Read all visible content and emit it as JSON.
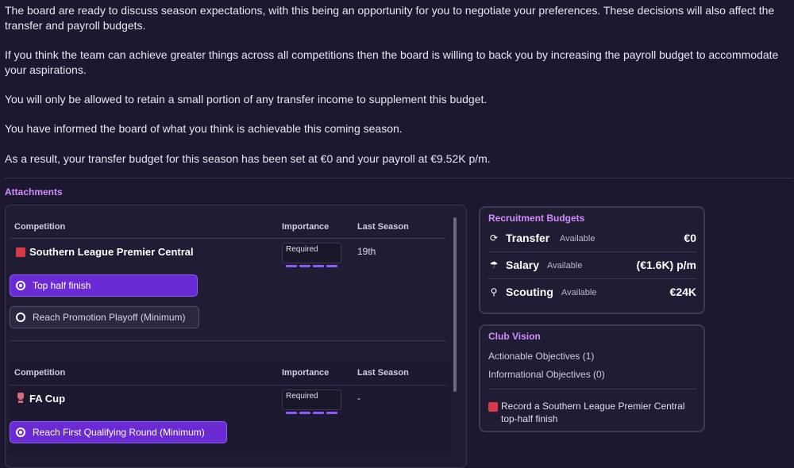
{
  "intro": {
    "p1": "The board are ready to discuss season expectations, with this being an opportunity for you to negotiate your preferences. These decisions will also affect the transfer and payroll budgets.",
    "p2": "If you think the team can achieve greater things across all competitions then the board is willing to back you by increasing the payroll budget to accommodate your aspirations.",
    "p3": "You will only be allowed to retain a small portion of any transfer income to supplement this budget.",
    "p4": "You have informed the board of what you think is achievable this coming season.",
    "p5": "As a result, your transfer budget for this season has been set at €0 and your payroll at €9.52K p/m."
  },
  "attachments": {
    "title": "Attachments",
    "columns": {
      "competition": "Competition",
      "importance": "Importance",
      "last_season": "Last Season"
    },
    "competitions": [
      {
        "name": "Southern League Premier Central",
        "importance": "Required",
        "last_season": "19th",
        "options": [
          {
            "label": "Top half finish",
            "selected": true
          },
          {
            "label": "Reach Promotion Playoff (Minimum)",
            "selected": false
          }
        ]
      },
      {
        "name": "FA Cup",
        "importance": "Required",
        "last_season": "-",
        "options": [
          {
            "label": "Reach First Qualifying Round (Minimum)",
            "selected": true
          }
        ]
      }
    ]
  },
  "recruitment": {
    "title": "Recruitment Budgets",
    "items": [
      {
        "icon": "transfer-icon",
        "name": "Transfer",
        "avail": "Available",
        "value": "€0"
      },
      {
        "icon": "salary-icon",
        "name": "Salary",
        "avail": "Available",
        "value": "(€1.6K) p/m"
      },
      {
        "icon": "scouting-icon",
        "name": "Scouting",
        "avail": "Available",
        "value": "€24K"
      }
    ]
  },
  "vision": {
    "title": "Club Vision",
    "actionable": "Actionable Objectives (1)",
    "informational": "Informational Objectives (0)",
    "objective": "Record a Southern League Premier Central top-half finish"
  },
  "colors": {
    "accent": "#d48cff",
    "selected": "#6b2bd4",
    "background": "#1b1830"
  }
}
